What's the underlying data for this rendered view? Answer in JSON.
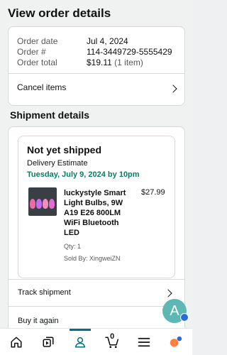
{
  "header": {
    "title": "View order details"
  },
  "order": {
    "date_label": "Order date",
    "date_value": "Jul 4, 2024",
    "number_label": "Order #",
    "number_value": "114-3449729-5555429",
    "total_label": "Order total",
    "total_value": "$19.11",
    "total_sub": "(1 item)",
    "cancel_label": "Cancel items"
  },
  "shipment": {
    "heading": "Shipment details",
    "status": "Not yet shipped",
    "estimate_label": "Delivery Estimate",
    "estimate_date": "Tuesday, July 9, 2024 by 10pm",
    "item": {
      "name": "luckystyle Smart Light Bulbs, 9W A19 E26 800LM WiFi Bluetooth LED",
      "price": "$27.99",
      "qty": "Qty: 1",
      "seller": "Sold By: XingweiZN"
    },
    "track_label": "Track shipment",
    "buy_again_label": "Buy it again"
  },
  "fab": {
    "letter": "A"
  },
  "nav": {
    "items": [
      "home-icon",
      "library-icon",
      "account-icon",
      "cart-icon",
      "menu-icon"
    ],
    "active": "account-icon",
    "cart_count": "0"
  },
  "colors": {
    "accent": "#007185",
    "delivery": "#067d62",
    "fab": "#5db8b3"
  }
}
